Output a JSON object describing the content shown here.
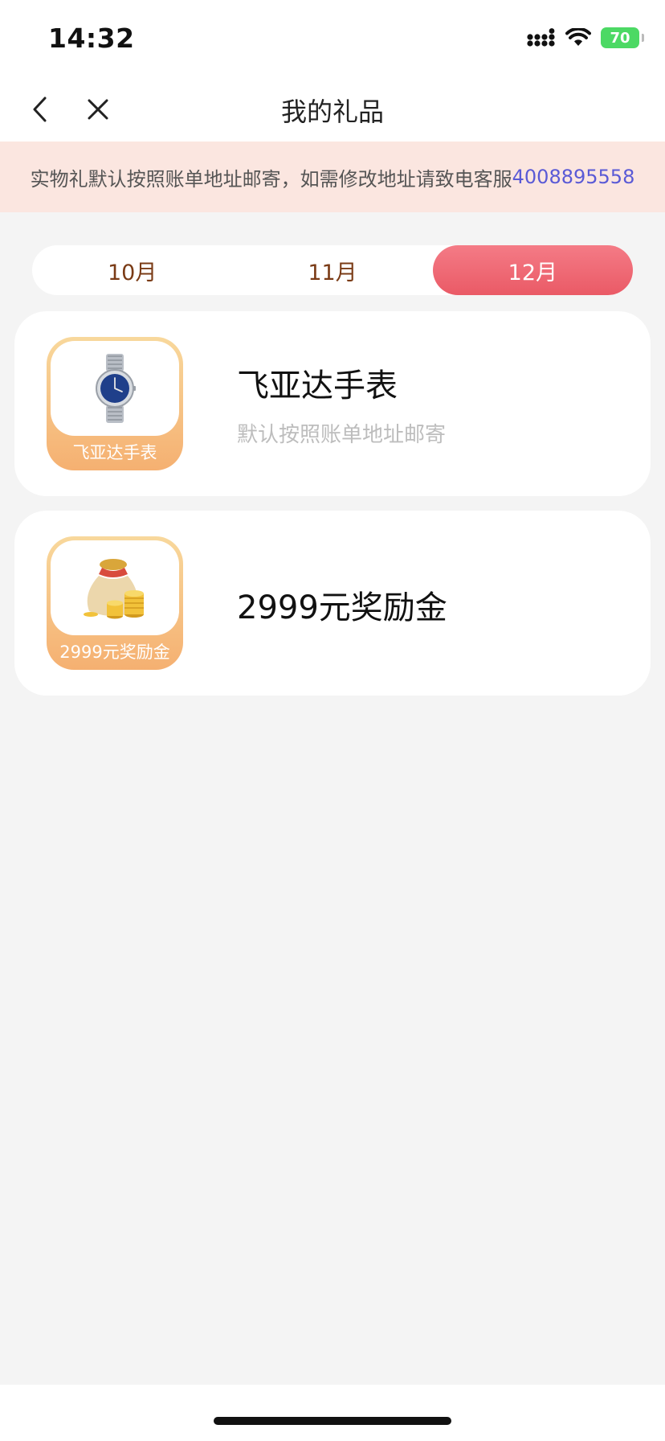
{
  "status_bar": {
    "time": "14:32",
    "battery": "70"
  },
  "nav": {
    "title": "我的礼品"
  },
  "notice": {
    "text": "实物礼默认按照账单地址邮寄，如需修改地址请致电客服",
    "phone": "4008895558"
  },
  "tabs": [
    {
      "label": "10月",
      "active": false
    },
    {
      "label": "11月",
      "active": false
    },
    {
      "label": "12月",
      "active": true
    }
  ],
  "gifts": [
    {
      "thumb_label": "飞亚达手表",
      "title": "飞亚达手表",
      "subtitle": "默认按照账单地址邮寄",
      "icon": "watch-icon"
    },
    {
      "thumb_label": "2999元奖励金",
      "title": "2999元奖励金",
      "icon": "money-bag-icon"
    }
  ],
  "colors": {
    "accent": "#ea5a66",
    "notice_bg": "#fbe6e0",
    "phone_link": "#5a5ad6",
    "tab_text": "#7a3b16"
  }
}
